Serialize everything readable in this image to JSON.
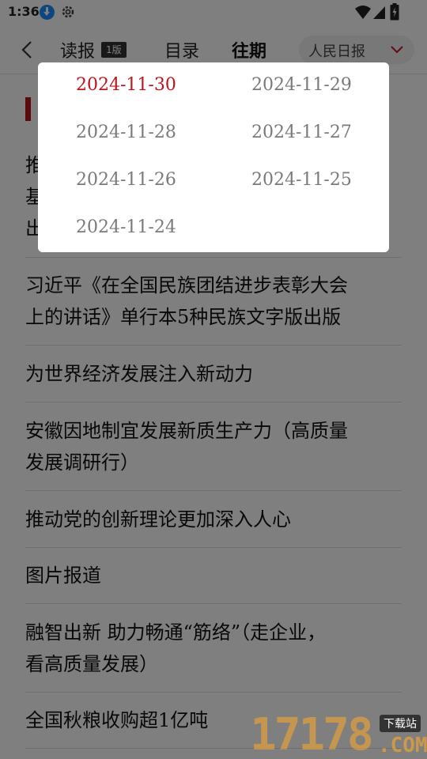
{
  "status_bar": {
    "time": "1:36"
  },
  "header": {
    "nav_read": "读报",
    "edition_badge": "1版",
    "nav_catalog": "目录",
    "nav_past": "往期",
    "paper_selector": "人民日报"
  },
  "articles": [
    {
      "lines": [
        "习近平《在全国民族团结进步表彰大会",
        "上的讲话》单行本5种民族文字版出版"
      ]
    },
    {
      "lines": [
        "为世界经济发展注入新动力"
      ]
    },
    {
      "lines": [
        "安徽因地制宜发展新质生产力（高质量",
        "发展调研行）"
      ]
    },
    {
      "lines": [
        "推动党的创新理论更加深入人心"
      ]
    },
    {
      "lines": [
        "图片报道"
      ]
    },
    {
      "lines": [
        "融智出新  助力畅通“筋络”（走企业，",
        "看高质量发展）"
      ]
    },
    {
      "lines": [
        "全国秋粮收购超1亿吨"
      ]
    }
  ],
  "hidden_article_fragments": [
    "推",
    "基",
    "出"
  ],
  "date_popup": {
    "dates": [
      "2024-11-30",
      "2024-11-29",
      "2024-11-28",
      "2024-11-27",
      "2024-11-26",
      "2024-11-25",
      "2024-11-24"
    ],
    "selected_index": 0
  },
  "watermark": {
    "number": "17178",
    "tag": "下载站",
    "suffix": ".COM"
  },
  "colors": {
    "accent_red": "#c0141c",
    "section_red": "#b5131a",
    "overlay": "rgba(0,0,0,0.5)",
    "download_blue": "#1a8cff"
  }
}
